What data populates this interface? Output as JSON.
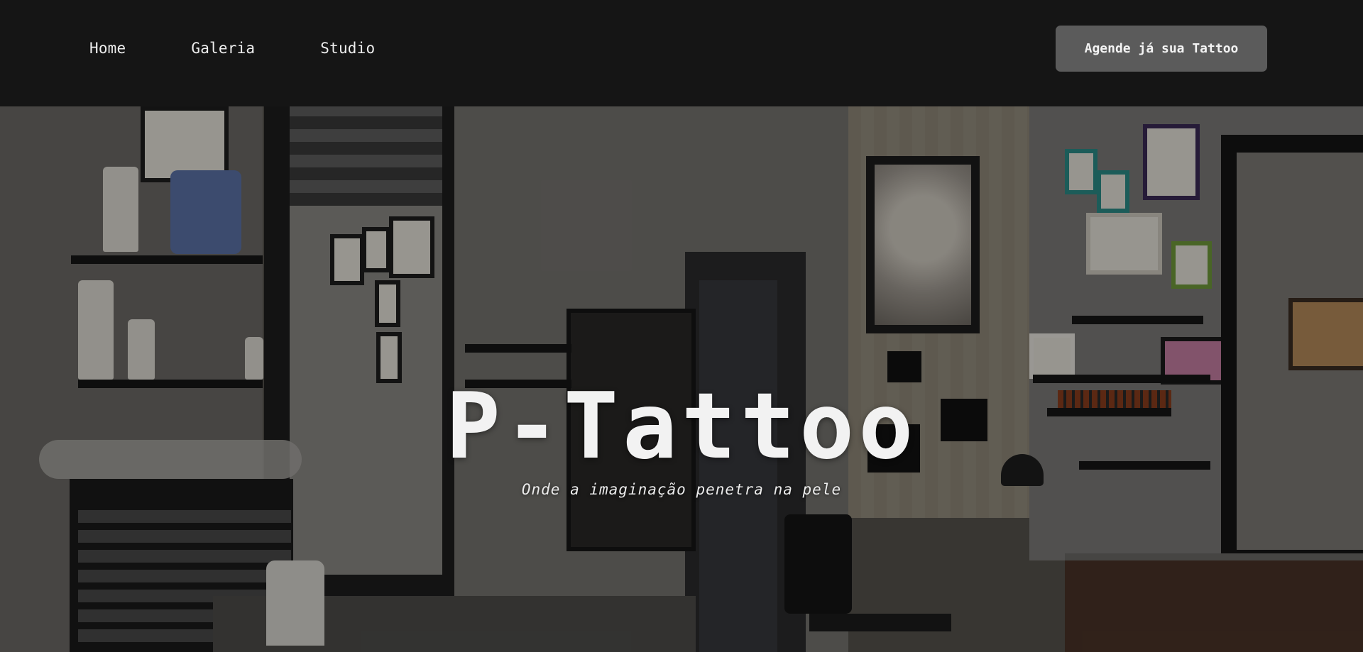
{
  "nav": {
    "items": [
      {
        "label": "Home"
      },
      {
        "label": "Galeria"
      },
      {
        "label": "Studio"
      }
    ],
    "cta_label": "Agende já sua Tattoo"
  },
  "hero": {
    "title": "P-Tattoo",
    "subtitle": "Onde a imaginação penetra na pele",
    "background": "tattoo-studio-interior-photo"
  },
  "colors": {
    "header_bg": "#151515",
    "cta_bg": "#5b5b5b",
    "text": "#f2f2f2"
  }
}
